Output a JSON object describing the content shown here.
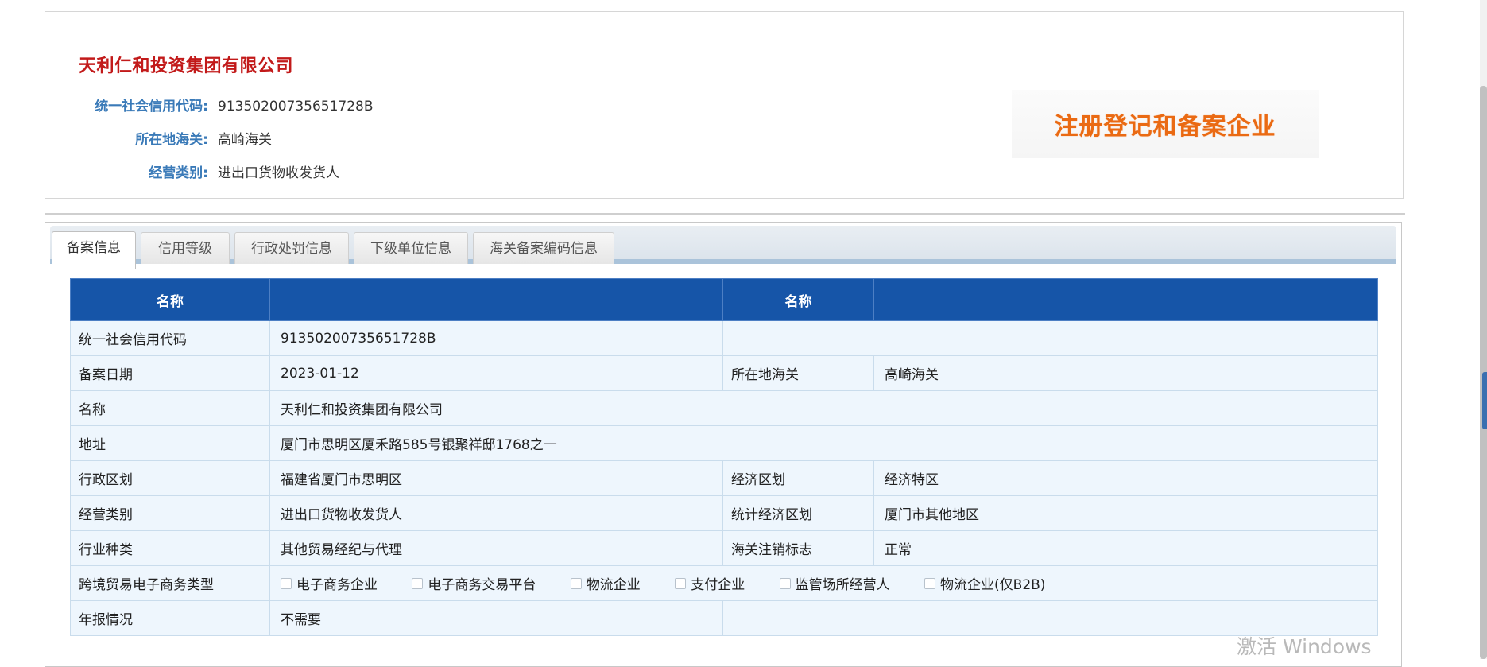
{
  "company": {
    "name": "天利仁和投资集团有限公司",
    "fields": [
      {
        "label": "统一社会信用代码:",
        "value": "91350200735651728B"
      },
      {
        "label": "所在地海关:",
        "value": "高崎海关"
      },
      {
        "label": "经营类别:",
        "value": "进出口货物收发货人"
      }
    ],
    "status_stamp": "注册登记和备案企业"
  },
  "tabs": [
    {
      "label": "备案信息",
      "active": true
    },
    {
      "label": "信用等级",
      "active": false
    },
    {
      "label": "行政处罚信息",
      "active": false
    },
    {
      "label": "下级单位信息",
      "active": false
    },
    {
      "label": "海关备案编码信息",
      "active": false
    }
  ],
  "table": {
    "header": {
      "col1": "名称",
      "col2": "",
      "col3": "名称",
      "col4": ""
    },
    "rows": {
      "credit_code": {
        "label": "统一社会信用代码",
        "value": "91350200735651728B"
      },
      "filing_date": {
        "label": "备案日期",
        "value": "2023-01-12",
        "label2": "所在地海关",
        "value2": "高崎海关"
      },
      "name": {
        "label": "名称",
        "value": "天利仁和投资集团有限公司"
      },
      "address": {
        "label": "地址",
        "value": "厦门市思明区厦禾路585号银聚祥邸1768之一"
      },
      "admin_region": {
        "label": "行政区划",
        "value": "福建省厦门市思明区",
        "label2": "经济区划",
        "value2": "经济特区"
      },
      "business_type": {
        "label": "经营类别",
        "value": "进出口货物收发货人",
        "label2": "统计经济区划",
        "value2": "厦门市其他地区"
      },
      "industry": {
        "label": "行业种类",
        "value": "其他贸易经纪与代理",
        "label2": "海关注销标志",
        "value2": "正常"
      },
      "ecommerce": {
        "label": "跨境贸易电子商务类型",
        "options": [
          "电子商务企业",
          "电子商务交易平台",
          "物流企业",
          "支付企业",
          "监管场所经营人",
          "物流企业(仅B2B)"
        ]
      },
      "annual_report": {
        "label": "年报情况",
        "value": "不需要"
      }
    }
  },
  "watermark": "激活 Windows",
  "colors": {
    "title_red": "#c21a1a",
    "label_blue": "#3a7ab8",
    "header_blue": "#1655a8",
    "stamp_orange": "#ea6a13"
  }
}
